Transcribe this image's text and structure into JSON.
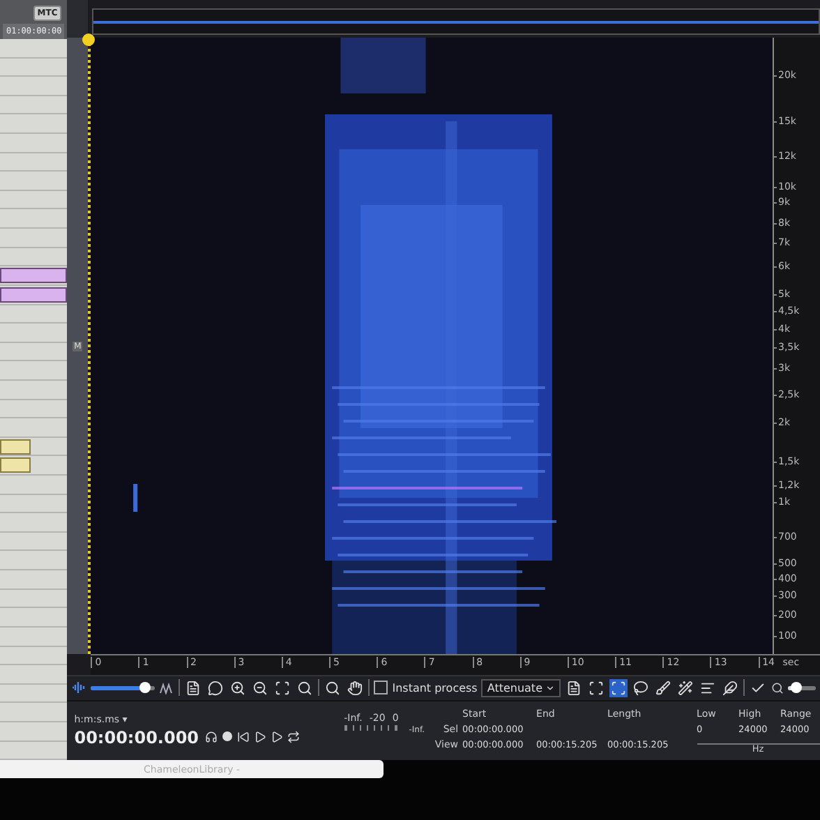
{
  "daw_panel": {
    "sync_button": "MTC",
    "timecode": "01:00:00:00"
  },
  "spectrogram": {
    "marker": "M",
    "freq_labels": [
      "20k",
      "15k",
      "12k",
      "10k",
      "9k",
      "8k",
      "7k",
      "6k",
      "5k",
      "4,5k",
      "4k",
      "3,5k",
      "3k",
      "2,5k",
      "2k",
      "1,5k",
      "1,2k",
      "1k",
      "700",
      "500",
      "400",
      "300",
      "200",
      "100"
    ],
    "time_labels": [
      "0",
      "1",
      "2",
      "3",
      "4",
      "5",
      "6",
      "7",
      "8",
      "9",
      "10",
      "11",
      "12",
      "13",
      "14"
    ],
    "time_unit": "sec"
  },
  "toolbar": {
    "zoom_slider": {
      "level": 0.85
    },
    "instant_process": {
      "label": "Instant process",
      "checked": false
    },
    "mode": "Attenuate",
    "tools": [
      {
        "kind": "time",
        "selected": false
      },
      {
        "kind": "freq",
        "selected": false
      },
      {
        "kind": "rect",
        "selected": true
      },
      {
        "kind": "lasso",
        "selected": false
      },
      {
        "kind": "brush",
        "selected": false
      },
      {
        "kind": "wand",
        "selected": false
      },
      {
        "kind": "harmonic",
        "selected": false
      },
      {
        "kind": "feather",
        "selected": false
      }
    ],
    "view_slider": {
      "level": 0.3
    }
  },
  "transport": {
    "time_format": "h:m:s.ms",
    "time_format_caret": "▾",
    "time": "00:00:00.000"
  },
  "meter": {
    "labels": [
      "-Inf.",
      "-20",
      "0"
    ],
    "peak": "-Inf."
  },
  "selection": {
    "columns": [
      "Start",
      "End",
      "Length"
    ],
    "rows": [
      {
        "label": "Sel",
        "cells": [
          "00:00:00.000"
        ]
      },
      {
        "label": "View",
        "cells": [
          "00:00:00.000",
          "00:00:15.205",
          "00:00:15.205"
        ]
      }
    ]
  },
  "frequency": {
    "columns": [
      "Low",
      "High",
      "Range"
    ],
    "values": [
      "0",
      "24000",
      "24000"
    ],
    "unit": "Hz"
  },
  "taskbar": {
    "title": "ChameleonLibrary -"
  }
}
